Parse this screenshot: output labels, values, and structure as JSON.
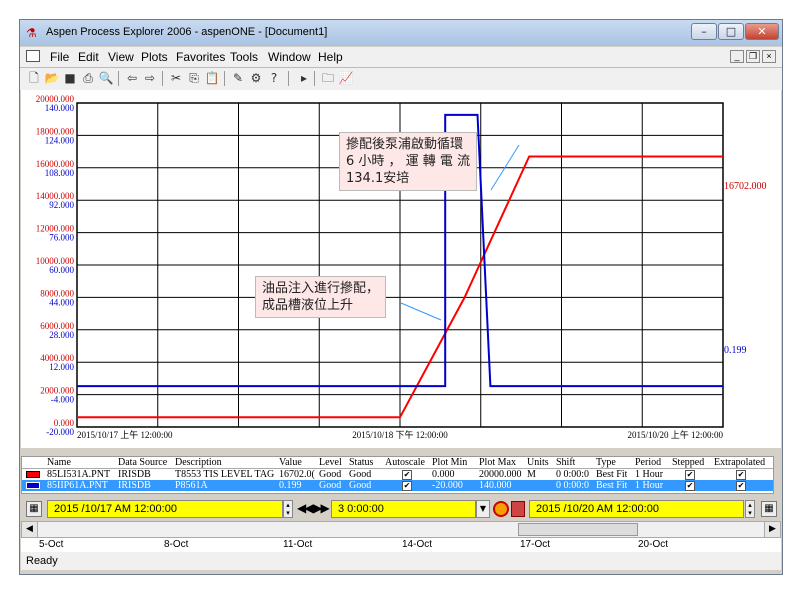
{
  "window": {
    "title": "Aspen Process Explorer 2006 - aspenONE - [Document1]",
    "controls": {
      "minimize": "–",
      "maximize": "□",
      "close": "✕"
    }
  },
  "menu": [
    "File",
    "Edit",
    "View",
    "Plots",
    "Favorites",
    "Tools",
    "Window",
    "Help"
  ],
  "mdi_controls": {
    "minimize": "_",
    "restore": "❐",
    "close": "×"
  },
  "toolbar_icons": [
    "new-icon",
    "open-icon",
    "save-icon",
    "print-icon",
    "print-preview-icon",
    "back-icon",
    "forward-icon",
    "cut-icon",
    "copy-icon",
    "paste-icon",
    "tag-icon",
    "trend-icon",
    "help-icon",
    "play-icon",
    "folder-icon",
    "chart-icon"
  ],
  "chart_data": {
    "type": "line",
    "x_labels": [
      "2015/10/17 上午 12:00:00",
      "2015/10/18 下午 12:00:00",
      "2015/10/20 上午 12:00:00"
    ],
    "y_axis_left_outer": [
      "20000.000",
      "18000.000",
      "16000.000",
      "14000.000",
      "12000.000",
      "10000.000",
      "8000.000",
      "6000.000",
      "4000.000",
      "2000.000",
      "0.000"
    ],
    "y_axis_left_inner": [
      "140.000",
      "124.000",
      "108.000",
      "92.000",
      "76.000",
      "60.000",
      "44.000",
      "28.000",
      "12.000",
      "-4.000",
      "-20.000"
    ],
    "series": [
      {
        "name": "85LI531A.PNT",
        "color": "#ff0000",
        "current_value_label": "16702.000",
        "points": [
          [
            0,
            600
          ],
          [
            40,
            600
          ],
          [
            50,
            600
          ],
          [
            60,
            8000
          ],
          [
            70,
            16700
          ],
          [
            100,
            16700
          ]
        ]
      },
      {
        "name": "85IIP61A.PNT",
        "color": "#0000cc",
        "current_value_label": "0.199",
        "points": [
          [
            0,
            0.2
          ],
          [
            57,
            0.2
          ],
          [
            57,
            134.1
          ],
          [
            62,
            134.1
          ],
          [
            64,
            0.2
          ],
          [
            100,
            0.199
          ]
        ]
      }
    ],
    "annotations": [
      {
        "text": "摻配後泵浦啟動循環\n6 小時 ， 運 轉 電 流\n134.1安培"
      },
      {
        "text": "油品注入進行摻配，\n成品槽液位上升"
      }
    ]
  },
  "legend": {
    "headers": [
      "Name",
      "Data Source",
      "Description",
      "Value",
      "Level",
      "Status",
      "Autoscale",
      "Plot Min",
      "Plot Max",
      "Units",
      "Shift",
      "Type",
      "Period",
      "Stepped",
      "Extrapolated"
    ],
    "rows": [
      [
        "85LI531A.PNT",
        "IRISDB",
        "T8553 TIS LEVEL TAG",
        "16702.0(",
        "Good",
        "Good",
        "✔",
        "0.000",
        "20000.000",
        "M",
        "0  0:00:0",
        "Best Fit",
        "1 Hour",
        "✔",
        "✔"
      ],
      [
        "85IIP61A.PNT",
        "IRISDB",
        "P8561A",
        "0.199",
        "Good",
        "Good",
        "✔",
        "-20.000",
        "140.000",
        "",
        "0  0:00:0",
        "Best Fit",
        "1 Hour",
        "✔",
        "✔"
      ]
    ]
  },
  "timebar": {
    "start": "2015 /10/17   AM  12:00:00",
    "span": "3  0:00:00",
    "end": "2015 /10/20   AM  12:00:00"
  },
  "timeline": [
    "5-Oct",
    "8-Oct",
    "11-Oct",
    "14-Oct",
    "17-Oct",
    "20-Oct"
  ],
  "status": "Ready"
}
